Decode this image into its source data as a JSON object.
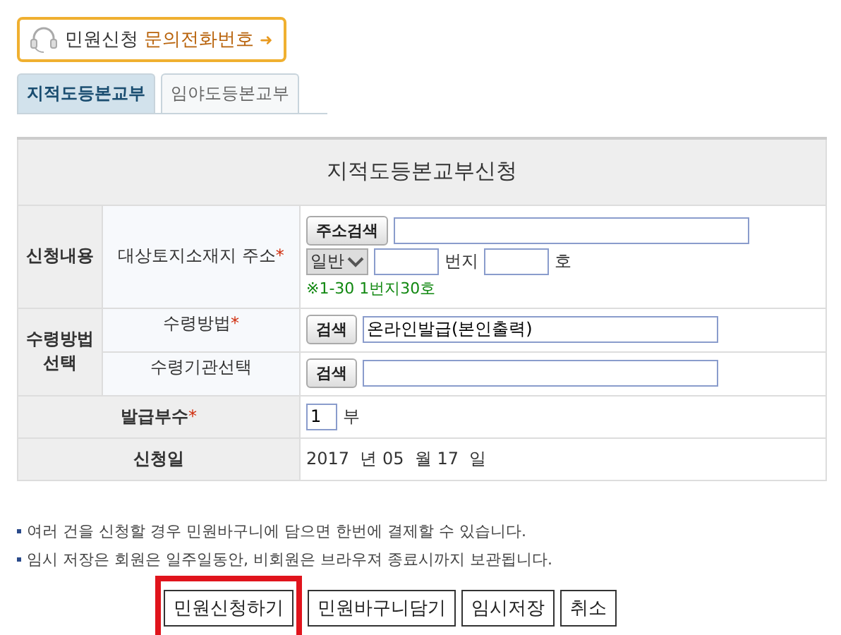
{
  "banner": {
    "label": "민원신청",
    "link": "문의전화번호",
    "arrow": "➜"
  },
  "tabs": [
    {
      "label": "지적도등본교부",
      "selected": true
    },
    {
      "label": "임야도등본교부",
      "selected": false
    }
  ],
  "form": {
    "title": "지적도등본교부신청",
    "section_1": {
      "heading": "신청내용",
      "label": "대상토지소재지 주소",
      "required_mark": "*",
      "search_button": "주소검색",
      "type_select": "일반",
      "lot_unit": "번지",
      "sub_unit": "호",
      "hint": "※1-30 1번지30호"
    },
    "section_2": {
      "heading": "수령방법 선택",
      "rows": [
        {
          "label": "수령방법",
          "required_mark": "*",
          "button": "검색",
          "value": "온라인발급(본인출력)"
        },
        {
          "label": "수령기관선택",
          "button": "검색"
        }
      ]
    },
    "copies": {
      "label": "발급부수",
      "required_mark": "*",
      "value": "1",
      "unit": "부"
    },
    "date": {
      "label": "신청일",
      "year": "2017",
      "year_unit": "년",
      "month": "05",
      "month_unit": "월",
      "day": "17",
      "day_unit": "일"
    }
  },
  "notes": [
    "여러 건을 신청할 경우 민원바구니에 담으면 한번에 결제할 수 있습니다.",
    "임시 저장은 회원은 일주일동안, 비회원은 브라우져 종료시까지 보관됩니다."
  ],
  "buttons": [
    {
      "label": "민원신청하기",
      "highlighted": true
    },
    {
      "label": "민원바구니담기",
      "highlighted": false
    },
    {
      "label": "임시저장",
      "highlighted": false
    },
    {
      "label": "취소",
      "highlighted": false
    }
  ]
}
